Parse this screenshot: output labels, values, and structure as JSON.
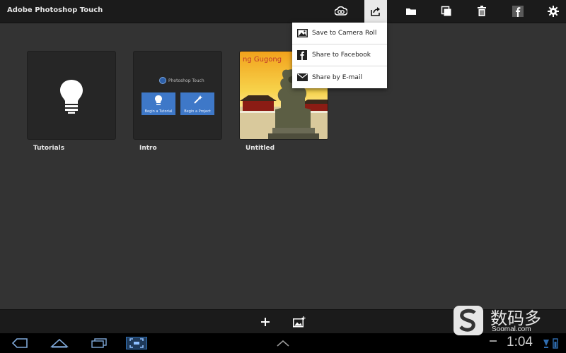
{
  "app": {
    "title": "Adobe Photoshop Touch"
  },
  "toolbar": {
    "icons": [
      "creative-cloud-icon",
      "share-icon",
      "folder-icon",
      "duplicate-icon",
      "trash-icon",
      "facebook-icon",
      "settings-icon"
    ],
    "active": "share-icon"
  },
  "share_menu": {
    "items": [
      {
        "label": "Save to Camera Roll",
        "icon": "image-icon"
      },
      {
        "label": "Share to Facebook",
        "icon": "facebook-icon"
      },
      {
        "label": "Share by E-mail",
        "icon": "envelope-icon"
      }
    ]
  },
  "projects": [
    {
      "caption": "Tutorials",
      "thumb": "lightbulb-icon"
    },
    {
      "caption": "Intro",
      "thumb": "intro-card",
      "card": {
        "logo_text": "Photoshop Touch",
        "btn1": "Begin a Tutorial",
        "btn2": "Begin a Project"
      }
    },
    {
      "caption": "Untitled",
      "thumb": "photo",
      "photo_text": "ng Gugong"
    }
  ],
  "bottom_bar": {
    "icons": [
      "add-icon",
      "add-image-icon"
    ]
  },
  "nav": {
    "icons": [
      "back-icon",
      "home-icon",
      "recent-apps-icon",
      "screenshot-icon",
      "chevron-up-icon"
    ],
    "clock": "1:04"
  },
  "watermark": {
    "zh": "数码多",
    "en": "Soomal.com"
  },
  "colors": {
    "background": "#333333",
    "bar": "#1b1b1b",
    "accent": "#3e78c8"
  }
}
